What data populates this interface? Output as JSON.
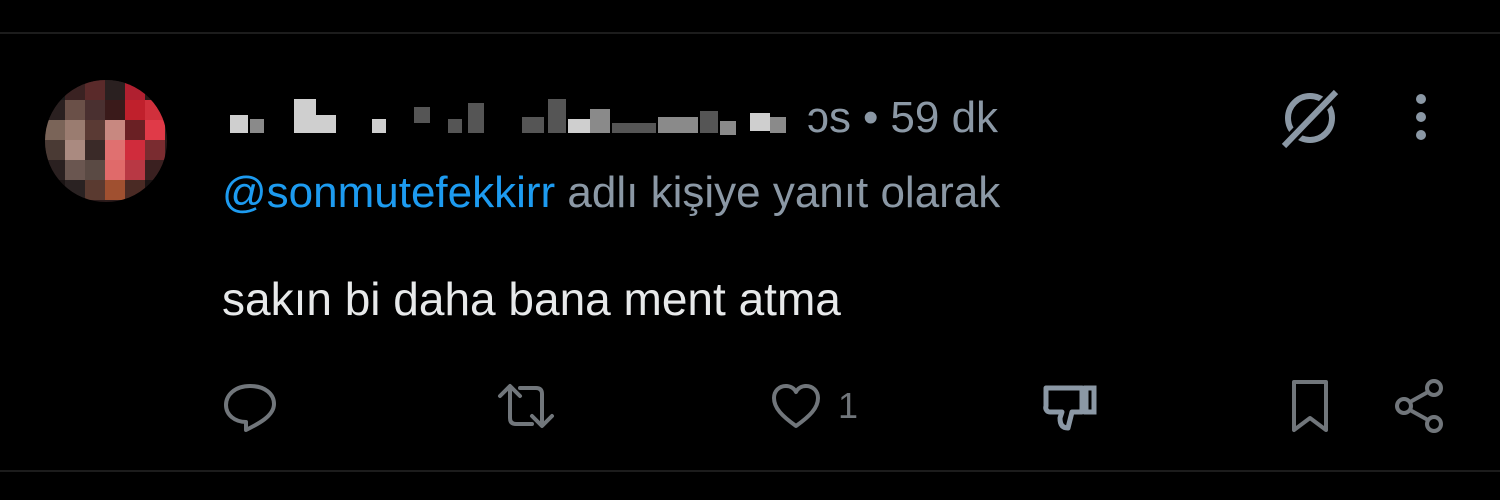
{
  "tweet": {
    "handle_tail": "ɔs",
    "separator": "•",
    "time": "59 dk",
    "reply_to": "@sonmutefekkirr",
    "reply_suffix": " adlı kişiye yanıt olarak",
    "text": "sakın bi daha bana ment atma"
  },
  "actions": {
    "reply_icon": "reply-icon",
    "retweet_icon": "retweet-icon",
    "like_icon": "heart-icon",
    "like_count": "1",
    "dislike_icon": "thumbs-down-icon",
    "bookmark_icon": "bookmark-icon",
    "share_icon": "share-icon"
  },
  "header": {
    "grok_icon": "grok-icon",
    "more_icon": "more-vertical-icon"
  },
  "colors": {
    "background": "#000000",
    "muted": "#8b98a5",
    "accent": "#1d9bf0",
    "text": "#e7e9ea"
  }
}
